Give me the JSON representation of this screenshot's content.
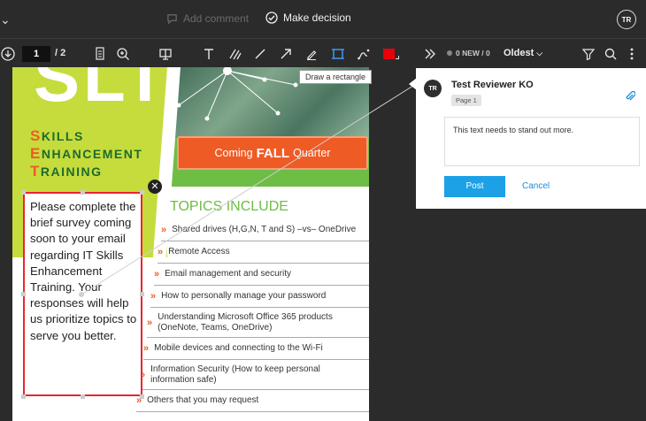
{
  "topbar": {
    "add_comment_label": "Add comment",
    "make_decision_label": "Make decision",
    "user_initials": "TR"
  },
  "toolbar": {
    "current_page": "1",
    "total_pages": "/ 2",
    "tooltip": "Draw a rectangle",
    "color_swatch": "#e8000b"
  },
  "document": {
    "big_letters": "SLT",
    "set_title_lines": [
      {
        "cap": "S",
        "rest": "KILLS"
      },
      {
        "cap": "E",
        "rest": "NHANCEMENT"
      },
      {
        "cap": "T",
        "rest": "RAINING"
      }
    ],
    "ribbon_pre": "Coming",
    "ribbon_bold": "FALL",
    "ribbon_post": "Quarter",
    "topics_heading": "TOPICS INCLUDE",
    "topics": [
      "Shared drives (H,G,N, T and S) –vs– OneDrive",
      "Remote Access",
      "Email management and security",
      "How to personally manage your password",
      "Understanding Microsoft Office 365 products (OneNote, Teams, OneDrive)",
      "Mobile devices and connecting to the Wi-Fi",
      "Information Security (How to keep personal information safe)",
      "Others that you may request"
    ],
    "note_text": "Please complete the brief survey coming soon to your email regarding IT Skills Enhancement Training. Your responses will help us prioritize topics to serve you better."
  },
  "panel": {
    "new_count": "0 NEW / 0",
    "sort_label": "Oldest",
    "reviewer_initials": "TR",
    "reviewer_name": "Test Reviewer KO",
    "page_badge": "Page 1",
    "comment_text": "This text needs to stand out more.",
    "post_label": "Post",
    "cancel_label": "Cancel"
  },
  "colors": {
    "accent_blue": "#1ca1e6",
    "highlight_red": "#e8262f",
    "brand_green": "#6ebd45",
    "brand_orange": "#ef5b25"
  }
}
